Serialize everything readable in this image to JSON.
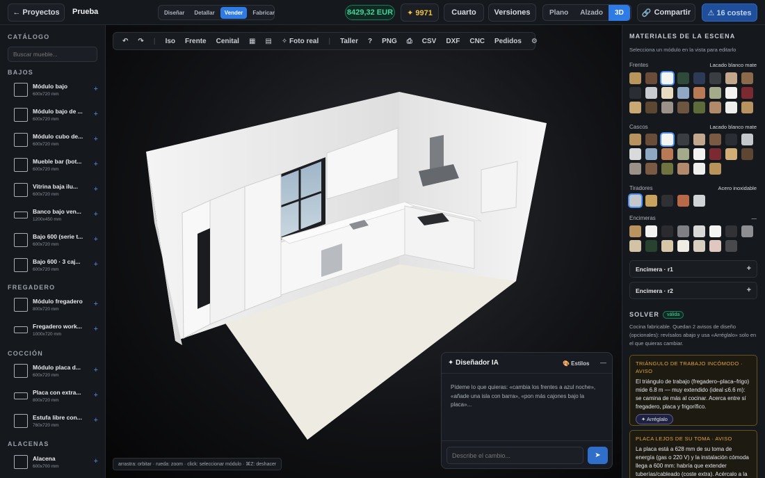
{
  "topbar": {
    "back_label": "← Proyectos",
    "project_name": "Prueba",
    "modes": [
      "Diseñar",
      "Detallar",
      "Vender",
      "Fabricar"
    ],
    "active_mode": "Vender",
    "price": "8429,32 EUR",
    "credits": "✦ 9971",
    "room_label": "Cuarto",
    "versions_label": "Versiones",
    "views": [
      "Plano",
      "Alzado",
      "3D"
    ],
    "active_view": "3D",
    "share_label": "Compartir",
    "costs_label": "⚠ 16 costes"
  },
  "sidebar": {
    "title": "CATÁLOGO",
    "search_placeholder": "Buscar mueble...",
    "sections": [
      {
        "title": "BAJOS",
        "items": [
          {
            "name": "Módulo bajo",
            "dims": "600x720 mm"
          },
          {
            "name": "Módulo bajo de ...",
            "dims": "600x720 mm"
          },
          {
            "name": "Módulo cubo de...",
            "dims": "600x720 mm"
          },
          {
            "name": "Mueble bar (bot...",
            "dims": "600x720 mm"
          },
          {
            "name": "Vitrina baja ilu...",
            "dims": "600x720 mm"
          },
          {
            "name": "Banco bajo ven...",
            "dims": "1200x450 mm"
          },
          {
            "name": "Bajo 600 (serie t...",
            "dims": "600x720 mm"
          },
          {
            "name": "Bajo 600 · 3 caj...",
            "dims": "600x720 mm"
          }
        ]
      },
      {
        "title": "FREGADERO",
        "items": [
          {
            "name": "Módulo fregadero",
            "dims": "800x720 mm"
          },
          {
            "name": "Fregadero work...",
            "dims": "1000x720 mm"
          }
        ]
      },
      {
        "title": "COCCIÓN",
        "items": [
          {
            "name": "Módulo placa d...",
            "dims": "600x720 mm"
          },
          {
            "name": "Placa con extra...",
            "dims": "800x720 mm"
          },
          {
            "name": "Estufa libre con...",
            "dims": "760x720 mm"
          }
        ]
      },
      {
        "title": "ALACENAS",
        "items": [
          {
            "name": "Alacena",
            "dims": "600x700 mm"
          }
        ]
      }
    ]
  },
  "toolbar": {
    "items": [
      "↶",
      "↷",
      "Iso",
      "Frente",
      "Cenital",
      "▦",
      "▤",
      "✧ Foto real",
      "Taller",
      "?",
      "PNG",
      "⎙",
      "CSV",
      "DXF",
      "CNC",
      "Pedidos",
      "⚙"
    ]
  },
  "viewport": {
    "hint": "arrastra: orbitar · rueda: zoom · click: seleccionar módulo · ⌘Z: deshacer"
  },
  "chat": {
    "title": "✦ Diseñador IA",
    "styles_label": "🎨 Estilos",
    "minimize": "—",
    "prompt": "Pídeme lo que quieras: «cambia los frentes a azul noche», «añade una isla con barra», «pon más cajones bajo la placa»...",
    "input_placeholder": "Describe el cambio...",
    "send_icon": "➤"
  },
  "materials": {
    "title": "MATERIALES DE LA ESCENA",
    "subtitle": "Selecciona un módulo en la vista para editarlo",
    "groups": [
      {
        "label": "Frentes",
        "value": "Lacado blanco mate",
        "colors": [
          "#b8955c",
          "#6a4d38",
          "#f4f4f2",
          "#2f4a3a",
          "#2c3a55",
          "#3a3d42",
          "#c2a78d",
          "#8a6a4a",
          "#2a2d33",
          "#c8cbcf",
          "#e8dcc0",
          "#8fa9c4",
          "#b87a55",
          "#a4ab8a",
          "#f2f2f0",
          "#7a2a30",
          "#c9a874",
          "#5d4632",
          "#9a9288",
          "#6e5540",
          "#5d6a3a",
          "#b08a6a",
          "#eeeeec",
          "#b89360"
        ],
        "selected": 2
      },
      {
        "label": "Cascos",
        "value": "Lacado blanco mate",
        "colors": [
          "#b89360",
          "#6a4d38",
          "#f4f4f2",
          "#3a3d42",
          "#c2a78d",
          "#7a5a42",
          "#2a2d33",
          "#c4c7cc",
          "#d8dadc",
          "#8fa9c4",
          "#b87a55",
          "#a4ab8a",
          "#f2f2f0",
          "#7a2a30",
          "#d1ad78",
          "#5d4632",
          "#9a9288",
          "#7a5a42",
          "#6e7340",
          "#b08a6a",
          "#eeeeec",
          "#b8935a"
        ],
        "selected": 2
      },
      {
        "label": "Tiradores",
        "value": "Acero inoxidable",
        "colors": [
          "#c4c8cd",
          "#c9a25e",
          "#2e3034",
          "#b86a48",
          "#d0d3d6"
        ],
        "selected": 0
      },
      {
        "label": "Encimeras",
        "value": "—",
        "colors": [
          "#b89360",
          "#f2f2f0",
          "#2a2b2e",
          "#7e8084",
          "#d8d8d6",
          "#f4f4f2",
          "#303236",
          "#8c8e92",
          "#d4c2a4",
          "#27422f",
          "#d8c6a8",
          "#efece4",
          "#d8cfc0",
          "#e0c8c0",
          "#48494c"
        ],
        "selected": -1
      }
    ],
    "counters": [
      {
        "label": "Encimera · r1"
      },
      {
        "label": "Encimera · r2"
      }
    ]
  },
  "solver": {
    "title": "SOLVER",
    "badge": "válida",
    "summary": "Cocina fabricable. Quedan 2 avisos de diseño (opcionales): revísalos abajo y usa «Arréglalo» solo en el que quieras cambiar.",
    "warnings": [
      {
        "title": "TRIÁNGULO DE TRABAJO INCÓMODO · AVISO",
        "body": "El triángulo de trabajo (fregadero–placa–frigo) mide 6.8 m — muy extendido (ideal ≤6.6 m): se camina de más al cocinar. Acerca entre sí fregadero, placa y frigorífico.",
        "fix_label": "✦ Arréglalo"
      },
      {
        "title": "PLACA LEJOS DE SU TOMA · AVISO",
        "body": "La placa está a 628 mm de su toma de energía (gas o 220 V) y la instalación cómoda llega a 600 mm: habría que extender tuberías/cableado (coste extra). Acércalo a la",
        "fix_label": ""
      }
    ]
  }
}
